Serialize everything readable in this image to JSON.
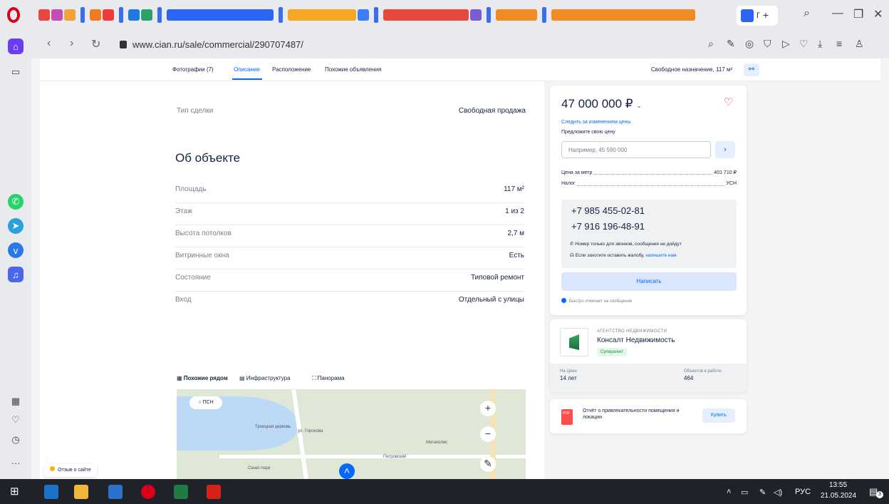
{
  "browser": {
    "url": "www.cian.ru/sale/commercial/290707487/",
    "active_tab_title": "П",
    "new_tab": "+"
  },
  "icons": {
    "tabs": [
      "tab-favicon-mail",
      "tab-favicon-music",
      "tab-favicon-yandex",
      "tab-favicon-ok",
      "tab-favicon-avito",
      "tab-favicon-cian",
      "tab-favicon-yandex-ads",
      "tab-favicon-vk",
      "tab-favicon-windows"
    ],
    "sidebar": [
      "whatsapp-icon",
      "telegram-icon",
      "vk-icon",
      "player-icon",
      "apps-icon",
      "heart-icon",
      "history-icon",
      "more-icon"
    ],
    "toolbar": [
      "search-icon",
      "edit-icon",
      "camera-icon",
      "vpn-icon",
      "send-icon",
      "heart-icon",
      "download-icon",
      "menu-icon",
      "profile-icon"
    ]
  },
  "subnav": {
    "photos": "Фотографии (7)",
    "description": "Описание",
    "location": "Расположение",
    "similar": "Похожие объявления",
    "summary": "Свободное назначение, 117 м²"
  },
  "deal": {
    "label": "Тип сделки",
    "value": "Свободная продажа"
  },
  "about": {
    "title": "Об объекте",
    "rows": [
      {
        "label": "Площадь",
        "value": "117 м²"
      },
      {
        "label": "Этаж",
        "value": "1 из 2"
      },
      {
        "label": "Высота потолков",
        "value": "2,7 м"
      },
      {
        "label": "Витринные окна",
        "value": "Есть"
      },
      {
        "label": "Состояние",
        "value": "Типовой ремонт"
      },
      {
        "label": "Вход",
        "value": "Отдельный с улицы"
      }
    ]
  },
  "map": {
    "tabs": [
      "Похожие рядом",
      "Инфраструктура",
      "Панорама"
    ],
    "filter": "ПСН",
    "labels": [
      "Троицкая церковь",
      "ул. Горохова",
      "Мегаполис",
      "Петровский",
      "Сенат-парк"
    ]
  },
  "feedback": "Отзыв о сайте",
  "price_card": {
    "price": "47 000 000 ₽",
    "follow": "Следить за изменением цены",
    "offer_label": "Предложите свою цену",
    "offer_placeholder": "Например, 45 590 000",
    "per_meter_label": "Цена за метр",
    "per_meter_value": "401 710 ₽",
    "tax_label": "Налог",
    "tax_value": "УСН",
    "phone1": "+7 985 455-02-81",
    "phone2": "+7 916 196-48-91",
    "note_calls": "Номер только для звонков, сообщения не дойдут",
    "note_complaint": "Если захотите оставить жалобу,",
    "note_complaint_link": "напишите нам",
    "write_button": "Написать",
    "fast_reply": "Быстро отвечает на сообщения"
  },
  "agent": {
    "type": "АГЕНТСТВО НЕДВИЖИМОСТИ",
    "name": "Консалт Недвижимость",
    "badge": "Суперагент",
    "years_label": "На Циан",
    "years_value": "14 лет",
    "objects_label": "Объектов в работе",
    "objects_value": "464"
  },
  "report": {
    "text": "Отчёт о привлекательности помещения и локации",
    "buy": "Купить"
  },
  "taskbar": {
    "lang": "РУС",
    "time": "13:55",
    "date": "21.05.2024",
    "notif": "3"
  }
}
